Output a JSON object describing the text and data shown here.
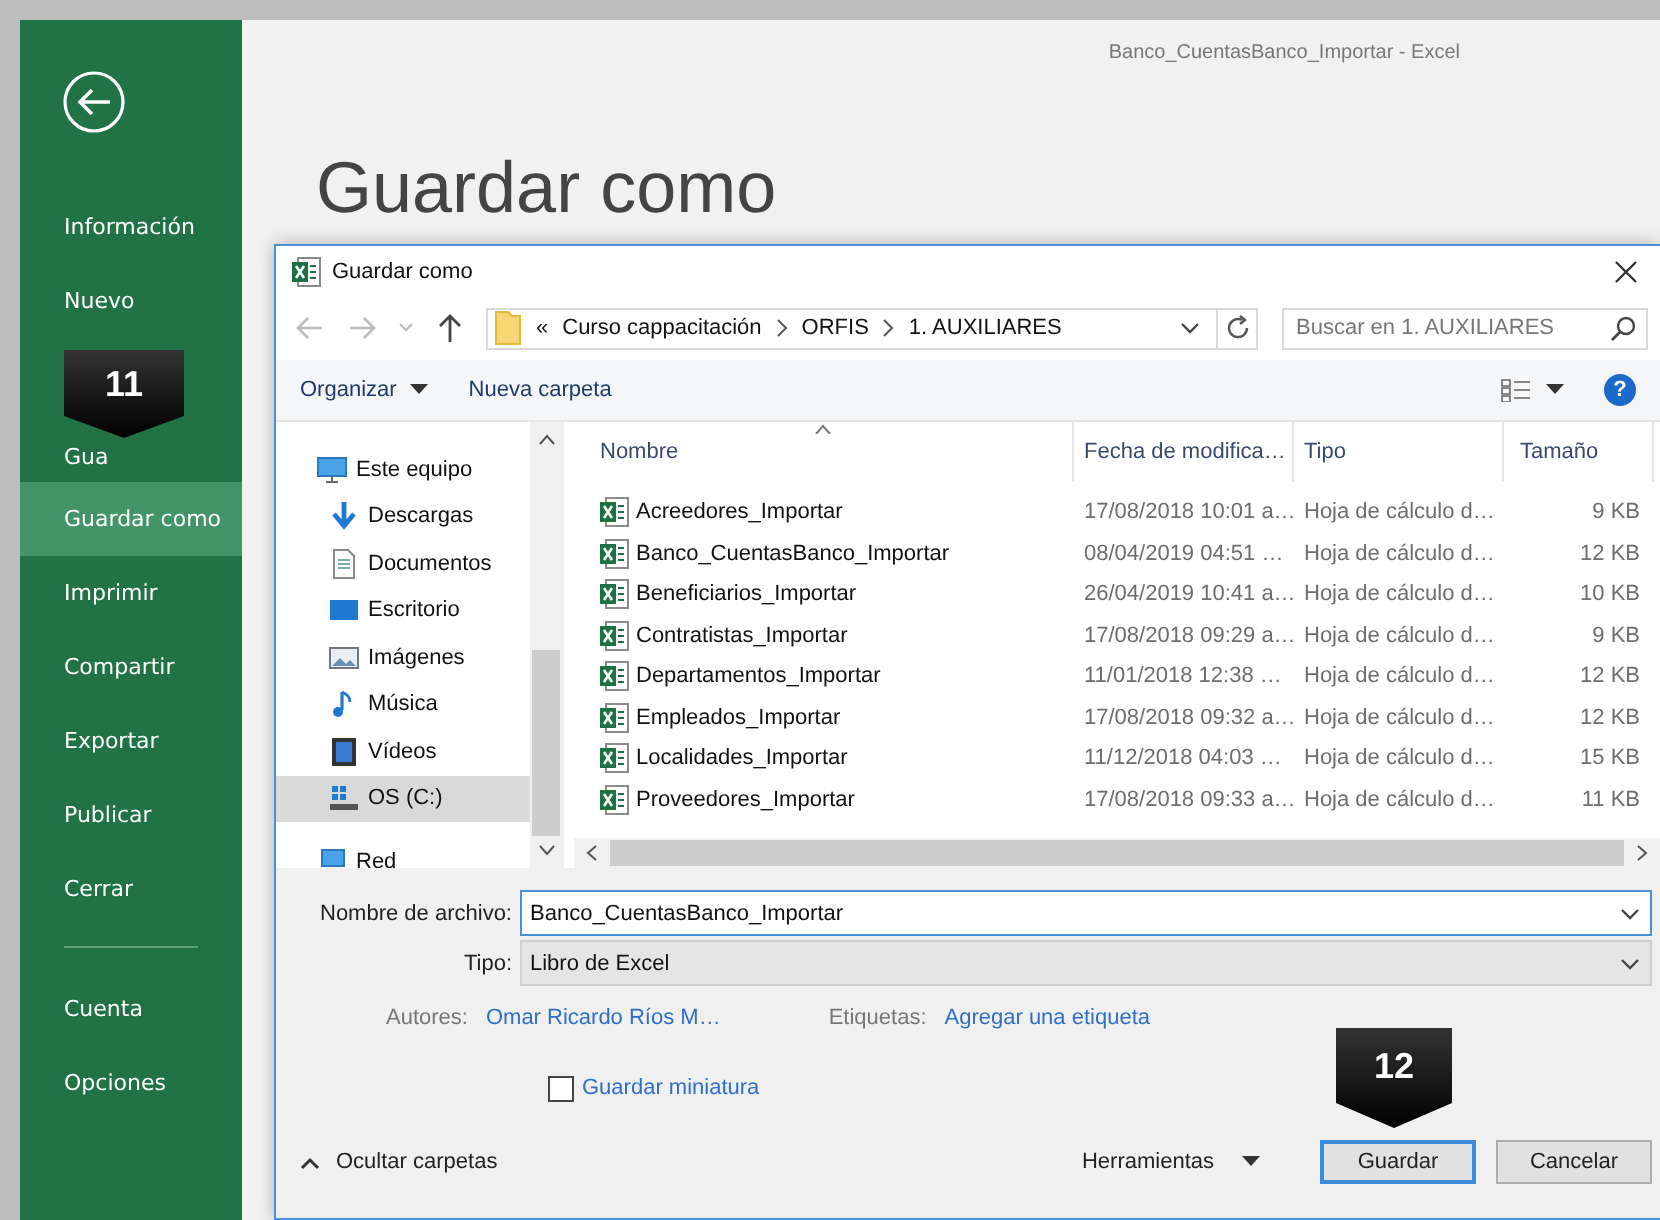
{
  "window": {
    "title": "Banco_CuentasBanco_Importar - Excel"
  },
  "backstage": {
    "step_badge": "11",
    "items": [
      {
        "label": "Información",
        "selected": false
      },
      {
        "label": "Nuevo",
        "selected": false
      },
      {
        "label": "Gua",
        "selected": false
      },
      {
        "label": "Guardar como",
        "selected": true
      },
      {
        "label": "Imprimir",
        "selected": false
      },
      {
        "label": "Compartir",
        "selected": false
      },
      {
        "label": "Exportar",
        "selected": false
      },
      {
        "label": "Publicar",
        "selected": false
      },
      {
        "label": "Cerrar",
        "selected": false
      }
    ],
    "bottom_items": [
      {
        "label": "Cuenta",
        "selected": false
      },
      {
        "label": "Opciones",
        "selected": false
      }
    ]
  },
  "heading": "Guardar como",
  "dialog": {
    "title": "Guardar como",
    "path": {
      "overflow": "«",
      "segments": [
        "Curso cappacitación",
        "ORFIS",
        "1. AUXILIARES"
      ]
    },
    "search": {
      "placeholder": "Buscar en 1. AUXILIARES"
    },
    "toolbar": {
      "organize": "Organizar",
      "new_folder": "Nueva carpeta",
      "help": "?"
    },
    "nav_pane": [
      {
        "label": "Este equipo",
        "kind": "computer",
        "selected": false,
        "children": [
          {
            "label": "Descargas",
            "kind": "download",
            "selected": false
          },
          {
            "label": "Documentos",
            "kind": "documents",
            "selected": false
          },
          {
            "label": "Escritorio",
            "kind": "desktop",
            "selected": false
          },
          {
            "label": "Imágenes",
            "kind": "pictures",
            "selected": false
          },
          {
            "label": "Música",
            "kind": "music",
            "selected": false
          },
          {
            "label": "Vídeos",
            "kind": "videos",
            "selected": false
          },
          {
            "label": "OS (C:)",
            "kind": "drive",
            "selected": true
          }
        ]
      },
      {
        "label": "Red",
        "kind": "network",
        "selected": false
      }
    ],
    "columns": [
      "Nombre",
      "Fecha de modifica…",
      "Tipo",
      "Tamaño"
    ],
    "rows": [
      {
        "name": "Acreedores_Importar",
        "date": "17/08/2018 10:01 a…",
        "type": "Hoja de cálculo d…",
        "size": "9 KB"
      },
      {
        "name": "Banco_CuentasBanco_Importar",
        "date": "08/04/2019 04:51 …",
        "type": "Hoja de cálculo d…",
        "size": "12 KB"
      },
      {
        "name": "Beneficiarios_Importar",
        "date": "26/04/2019 10:41 a…",
        "type": "Hoja de cálculo d…",
        "size": "10 KB"
      },
      {
        "name": "Contratistas_Importar",
        "date": "17/08/2018 09:29 a…",
        "type": "Hoja de cálculo d…",
        "size": "9 KB"
      },
      {
        "name": "Departamentos_Importar",
        "date": "11/01/2018 12:38 …",
        "type": "Hoja de cálculo d…",
        "size": "12 KB"
      },
      {
        "name": "Empleados_Importar",
        "date": "17/08/2018 09:32 a…",
        "type": "Hoja de cálculo d…",
        "size": "12 KB"
      },
      {
        "name": "Localidades_Importar",
        "date": "11/12/2018 04:03 …",
        "type": "Hoja de cálculo d…",
        "size": "15 KB"
      },
      {
        "name": "Proveedores_Importar",
        "date": "17/08/2018 09:33 a…",
        "type": "Hoja de cálculo d…",
        "size": "11 KB"
      }
    ],
    "filename": {
      "label": "Nombre de archivo:",
      "value": "Banco_CuentasBanco_Importar"
    },
    "file_type": {
      "label": "Tipo:",
      "value": "Libro de Excel"
    },
    "authors": {
      "label": "Autores:",
      "value": "Omar Ricardo Ríos M…"
    },
    "tags": {
      "label": "Etiquetas:",
      "value": "Agregar una etiqueta"
    },
    "thumbnail": {
      "label": "Guardar miniatura",
      "checked": false
    },
    "step_badge": "12",
    "hide_folders": "Ocultar carpetas",
    "tools": "Herramientas",
    "buttons": {
      "save": "Guardar",
      "cancel": "Cancelar"
    }
  }
}
